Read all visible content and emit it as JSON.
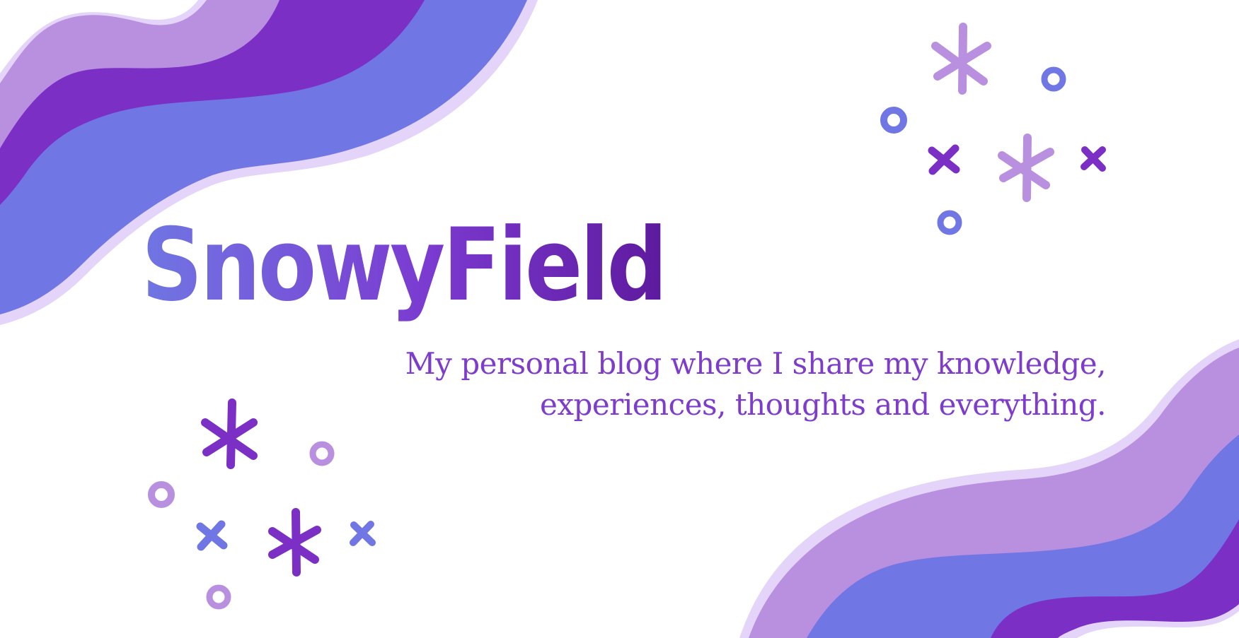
{
  "brand": {
    "logo_text": "SnowyField",
    "tagline_line1": "My personal blog where I share my knowledge,",
    "tagline_line2": "experiences, thoughts and everything."
  },
  "colors": {
    "lavender": "#b98fe0",
    "purple": "#7b2fc4",
    "periwinkle": "#7076e3",
    "outline": "#e4d4fa",
    "accent_green": "#2fdf97",
    "text_purple": "#7e3ccd"
  },
  "icons": {
    "logo_o": "snowflake-icon",
    "decorations": [
      "asterisk-icon",
      "cross-icon",
      "circle-icon"
    ]
  }
}
